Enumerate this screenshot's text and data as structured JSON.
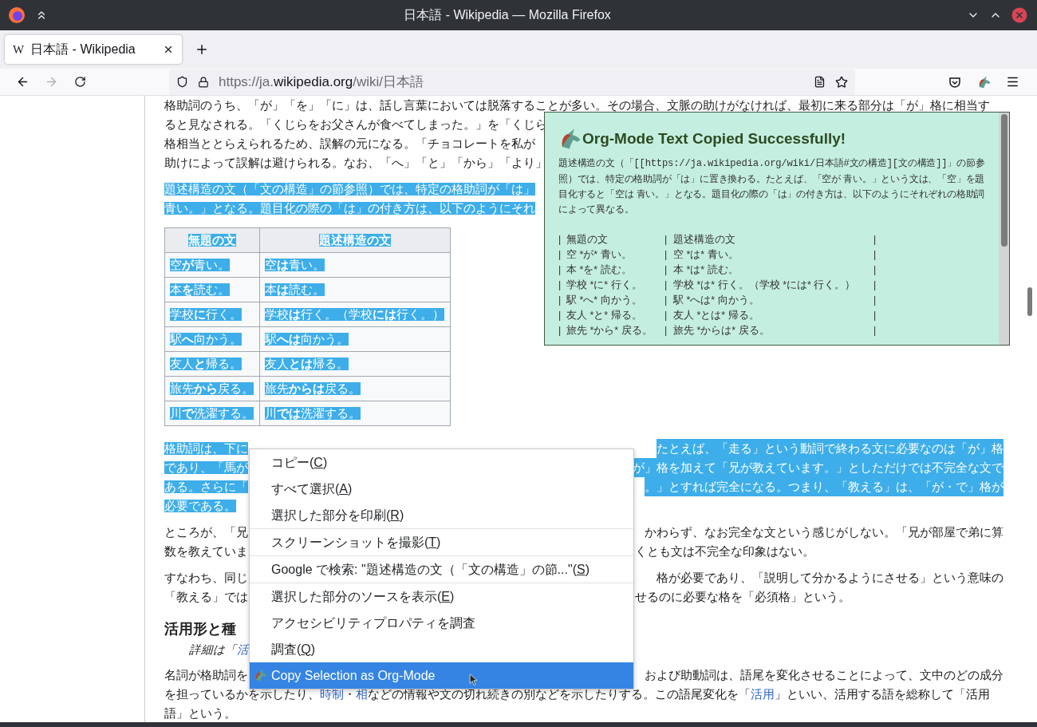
{
  "window": {
    "title": "日本語 - Wikipedia — Mozilla Firefox"
  },
  "tabs": [
    {
      "favicon": "W",
      "label": "日本語 - Wikipedia",
      "selected": true
    }
  ],
  "toolbar": {
    "back": {
      "disabled": false
    },
    "forward": {
      "disabled": true
    }
  },
  "address": {
    "scheme": "https://ja.",
    "domain": "wikipedia.org",
    "path": "/wiki/日本語"
  },
  "article": {
    "blocks": [
      {
        "kind": "paragraph",
        "selected": false,
        "lines": [
          {
            "left": "格助詞のうち、「が」「を」「に」は、話し言葉においては脱落することが多い。その場合、文脈の助けがなければ、最初に来る部分は「が」格に相当す"
          },
          {
            "left": "ると見なされる。「くじらをお父さんが食べてしまった。」を「くじら"
          },
          {
            "left": "格相当ととらえられるため、誤解の元になる。「チョコレートを私が"
          },
          {
            "left": "助けによって誤解は避けられる。なお、「へ」「と」「から」「より」"
          }
        ]
      },
      {
        "kind": "paragraph",
        "selected": true,
        "lines": [
          {
            "left": "題述構造の文（「文の構造」の節参照）では、特定の格助詞が「は」"
          },
          {
            "left": "青い。」となる。題目化の際の「は」の付き方は、以下のようにそれ"
          }
        ]
      },
      {
        "kind": "table",
        "selected": true,
        "columns": [
          "無題の文",
          "題述構造の文"
        ],
        "rows": [
          [
            "空**が**青い。",
            "空**は**青い。"
          ],
          [
            "本**を**読む。",
            "本**は**読む。"
          ],
          [
            "学校**に**行く。",
            "学校**は**行く。（学校**には**行く。）"
          ],
          [
            "駅**へ**向かう。",
            "駅**へは**向かう。"
          ],
          [
            "友人**と**帰る。",
            "友人**とは**帰る。"
          ],
          [
            "旅先**から**戻る。",
            "旅先**からは**戻る。"
          ],
          [
            "川**で**洗濯する。",
            "川**では**洗濯する。"
          ]
        ]
      },
      {
        "kind": "paragraph",
        "selected": true,
        "lines": [
          {
            "left": "格助詞は、下に",
            "right": "たとえば、「走る」という動詞で終わる文に必要なのは「が」格"
          },
          {
            "left": "であり、「馬が",
            "right": "が」格を加えて「兄が教えています。」としただけでは不完全な文で"
          },
          {
            "left": "ある。さらに「",
            "right": "。」とすれば完全になる。つまり、「教える」は、「が・で」格が"
          },
          {
            "left": "必要である。"
          }
        ]
      },
      {
        "kind": "paragraph",
        "selected": false,
        "lines": [
          {
            "left": "ところが、「兄",
            "right": "かわらず、なお完全な文という感じがしない。「兄が部屋で弟に算"
          },
          {
            "left": "数を教えていま",
            "right": "くとも文は不完全な印象はない。"
          }
        ]
      },
      {
        "kind": "paragraph",
        "selected": false,
        "lines": [
          {
            "left": "すなわち、同じ",
            "right": "格が必要であり、「説明して分かるようにさせる」という意味の"
          },
          {
            "left": "「教える」では",
            "right": "せるのに必要な格を「必須格」という。"
          }
        ]
      },
      {
        "kind": "heading",
        "text": "活用形と種"
      },
      {
        "kind": "note",
        "segments": [
          {
            "kind": "text",
            "text": "詳細は「"
          },
          {
            "kind": "link",
            "text": "活"
          }
        ]
      },
      {
        "kind": "paragraph",
        "selected": false,
        "lines": [
          {
            "left": "名詞が格助詞を",
            "right": "および助動詞は、語尾を変化させることによって、文中のどの成分"
          },
          {
            "segments": [
              {
                "kind": "text",
                "text": "を担っているかを示したり、"
              },
              {
                "kind": "link",
                "text": "時制"
              },
              {
                "kind": "text",
                "text": "・"
              },
              {
                "kind": "link",
                "text": "相"
              },
              {
                "kind": "text",
                "text": "などの情報や文の切れ続きの別などを示したりする。この語尾変化を「"
              },
              {
                "kind": "link",
                "text": "活用"
              },
              {
                "kind": "text",
                "text": "」といい、活用する語を総称して「活用"
              }
            ]
          },
          {
            "left": "語」という。"
          }
        ]
      }
    ]
  },
  "popup": {
    "title": "Org-Mode Text Copied Successfully!",
    "body": [
      {
        "kind": "text",
        "text": "題述構造の文（「"
      },
      {
        "kind": "code",
        "text": "[[https://ja.wikipedia.org/wiki/日本語#文の構造][文の構造]]"
      },
      {
        "kind": "text",
        "text": "」の節参照）では、特定の格助詞が「は」に置き換わる。たとえば、「空が 青い。」という文は、「空」を題目化すると「空は 青い。」となる。題目化の際の「は」の付き方は、以下のようにそれぞれの格助詞によって異なる。"
      }
    ],
    "separator": "|",
    "rows": [
      [
        "無題の文",
        "題述構造の文"
      ],
      [
        "空 *が* 青い。",
        "空 *は* 青い。"
      ],
      [
        "本 *を* 読む。",
        "本 *は* 読む。"
      ],
      [
        "学校 *に* 行く。",
        "学校 *は* 行く。（学校 *には* 行く。）"
      ],
      [
        "駅 *へ* 向かう。",
        "駅 *へは* 向かう。"
      ],
      [
        "友人 *と* 帰る。",
        "友人 *とは* 帰る。"
      ],
      [
        "旅先 *から* 戻る。",
        "旅先 *からは* 戻る。"
      ]
    ]
  },
  "context_menu": {
    "groups": [
      [
        {
          "before": "コピー(",
          "key": "C",
          "after": ")",
          "selected": false
        },
        {
          "before": "すべて選択(",
          "key": "A",
          "after": ")",
          "selected": false
        },
        {
          "before": "選択した部分を印刷(",
          "key": "R",
          "after": ")",
          "selected": false
        }
      ],
      [
        {
          "before": "スクリーンショットを撮影(",
          "key": "T",
          "after": ")",
          "selected": false
        }
      ],
      [
        {
          "before": "Google で検索: \"題述構造の文（「文の構造」の節...\"(",
          "key": "S",
          "after": ")",
          "selected": false
        }
      ],
      [
        {
          "before": "選択した部分のソースを表示(",
          "key": "E",
          "after": ")",
          "selected": false
        },
        {
          "before": "アクセシビリティプロパティを調査",
          "selected": false
        },
        {
          "before": "調査(",
          "key": "Q",
          "after": ")",
          "selected": false
        },
        {
          "before": "Copy Selection as Org-Mode",
          "kind": "extension",
          "selected": true
        }
      ]
    ]
  }
}
